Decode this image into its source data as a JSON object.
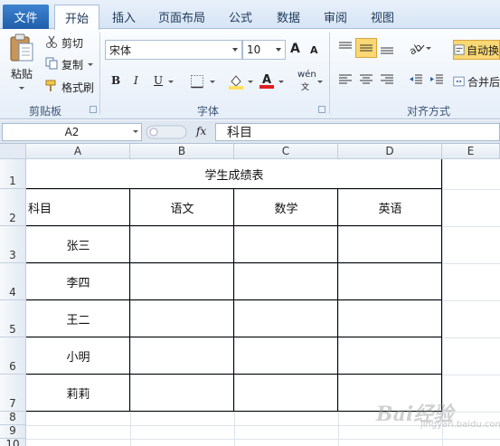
{
  "tabs": {
    "file": "文件",
    "items": [
      "开始",
      "插入",
      "页面布局",
      "公式",
      "数据",
      "审阅",
      "视图"
    ],
    "active_index": 0
  },
  "ribbon": {
    "clipboard": {
      "paste": "粘贴",
      "cut": "剪切",
      "copy": "复制",
      "format_painter": "格式刷",
      "label": "剪贴板"
    },
    "font": {
      "name": "宋体",
      "size": "10",
      "bold": "B",
      "italic": "I",
      "underline": "U",
      "grow": "A",
      "shrink": "A",
      "phonetic": "wén",
      "label": "字体"
    },
    "alignment": {
      "wrap_text": "自动换",
      "merge": "合并后",
      "label": "对齐方式"
    }
  },
  "formula_bar": {
    "name_box": "A2",
    "fx": "fx",
    "content": "科目"
  },
  "sheet": {
    "columns": [
      "A",
      "B",
      "C",
      "D",
      "E"
    ],
    "rows": [
      "1",
      "2",
      "3",
      "4",
      "5",
      "6",
      "7",
      "8",
      "9",
      "10"
    ],
    "title": "学生成绩表",
    "header": [
      "科目",
      "语文",
      "数学",
      "英语"
    ],
    "students": [
      "张三",
      "李四",
      "王二",
      "小明",
      "莉莉"
    ]
  },
  "watermark": {
    "main": "Bai经验",
    "sub": "jingyan.baidu.com"
  },
  "colors": {
    "file_tab": "#2b6fbf",
    "tab_text": "#1e395b",
    "highlight_yellow": "#ffe060",
    "font_color_red": "#e02020"
  }
}
